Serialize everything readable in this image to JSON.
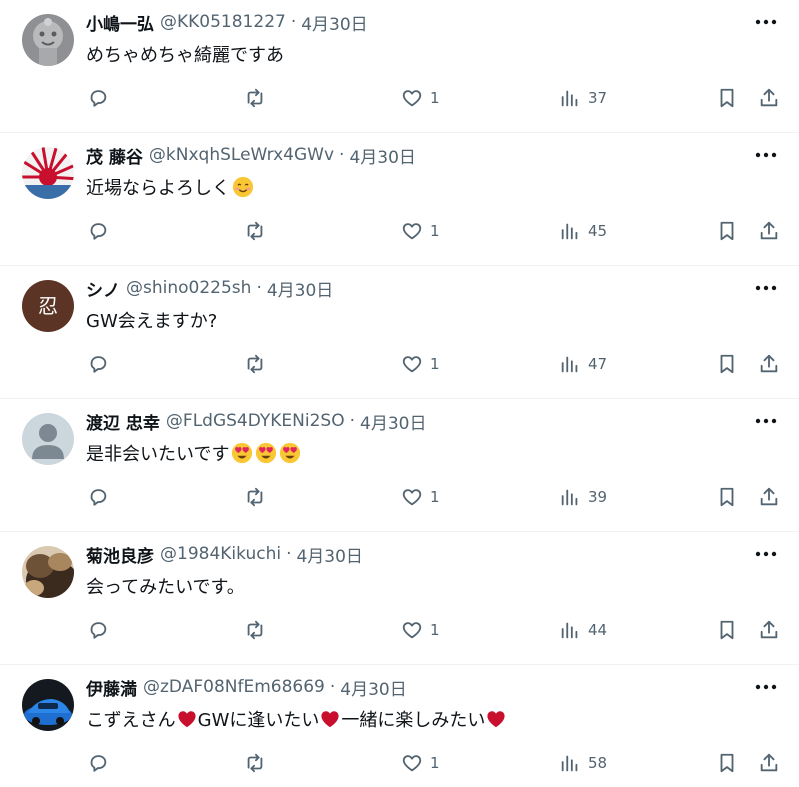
{
  "tweets": [
    {
      "display_name": "小嶋一弘",
      "handle": "@KK05181227",
      "separator": "·",
      "date": "4月30日",
      "text_parts": [
        "めちゃめちゃ綺麗ですあ"
      ],
      "like_count": "1",
      "view_count": "37",
      "avatar": "statue-face"
    },
    {
      "display_name": "茂 藤谷",
      "handle": "@kNxqhSLeWrx4GWv",
      "separator": "·",
      "date": "4月30日",
      "text_parts": [
        "近場ならよろしく"
      ],
      "trailing_emoji": "smiling-face-emoji",
      "like_count": "1",
      "view_count": "45",
      "avatar": "rising-sun-flag"
    },
    {
      "display_name": "シノ",
      "handle": "@shino0225sh",
      "separator": "·",
      "date": "4月30日",
      "text_parts": [
        "GW会えますか?"
      ],
      "like_count": "1",
      "view_count": "47",
      "avatar": "kanji-badge",
      "avatar_text": "忍"
    },
    {
      "display_name": "渡辺 忠幸",
      "handle": "@FLdGS4DYKENi2SO",
      "separator": "·",
      "date": "4月30日",
      "text_parts": [
        "是非会いたいです"
      ],
      "trailing_emoji": "heart-eyes-emoji",
      "like_count": "1",
      "view_count": "39",
      "avatar": "default-person"
    },
    {
      "display_name": "菊池良彦",
      "handle": "@1984Kikuchi",
      "separator": "·",
      "date": "4月30日",
      "text_parts": [
        "会ってみたいです。"
      ],
      "like_count": "1",
      "view_count": "44",
      "avatar": "photo-hair"
    },
    {
      "display_name": "伊藤満",
      "handle": "@zDAF08NfEm68669",
      "separator": "·",
      "date": "4月30日",
      "text_parts": [
        "こずえさん",
        "GWに逢いたい",
        "一緒に楽しみたい"
      ],
      "inline_emoji": "red-heart-emoji",
      "like_count": "1",
      "view_count": "58",
      "avatar": "blue-car"
    }
  ],
  "icons": {
    "reply": "reply-icon",
    "retweet": "retweet-icon",
    "like": "like-icon",
    "views": "views-icon",
    "bookmark": "bookmark-icon",
    "share": "share-icon",
    "more": "more-icon"
  },
  "colors": {
    "text": "#0f1419",
    "secondary": "#536471",
    "divider": "#eff3f4",
    "heart": "#c8102e",
    "emoji": "#f9c634"
  }
}
